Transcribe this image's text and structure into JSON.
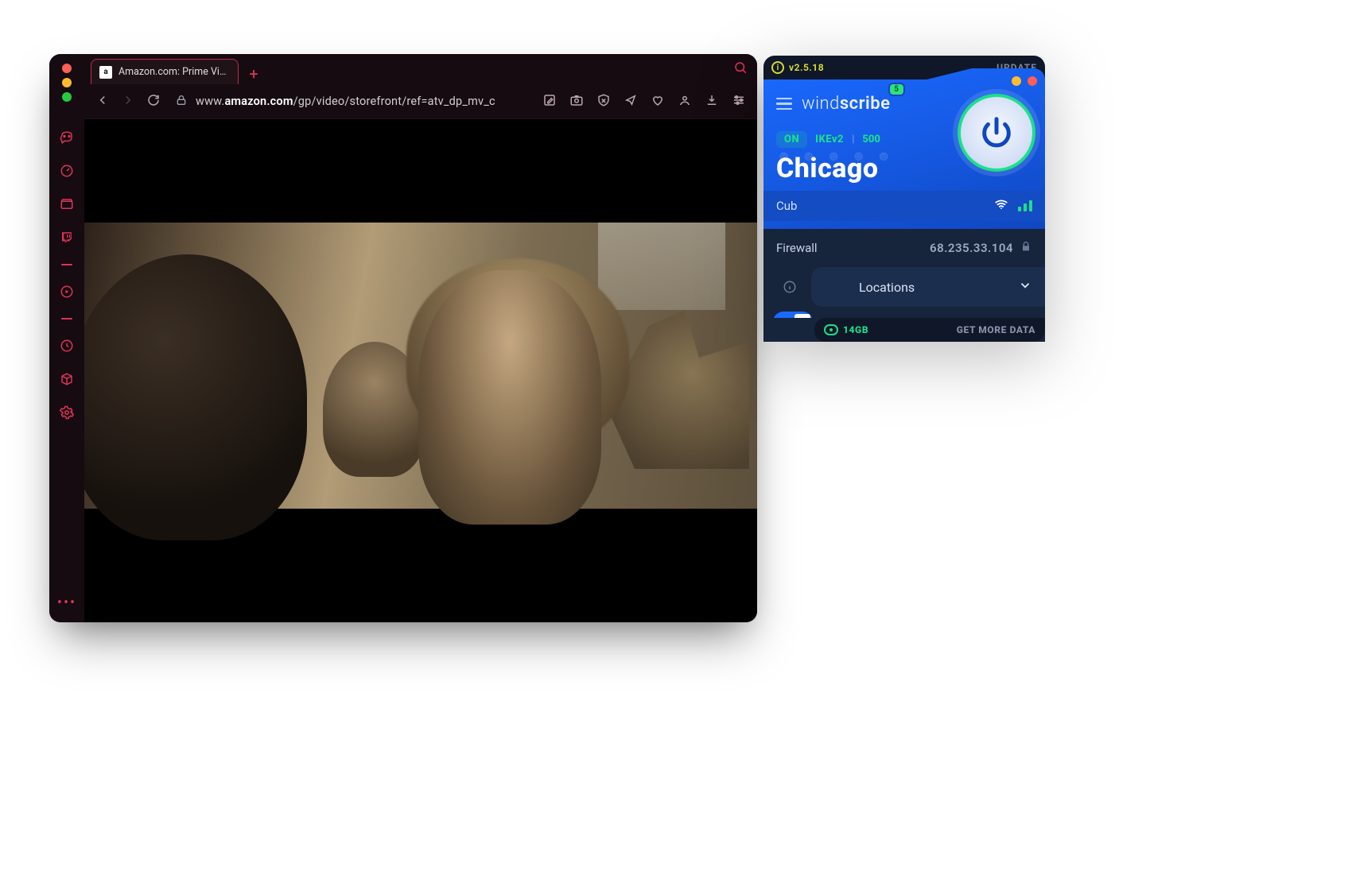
{
  "browser": {
    "tab_title": "Amazon.com: Prime Video: Prim",
    "favicon_letter": "a",
    "url_prefix": "www.",
    "url_host": "amazon.com",
    "url_path": "/gp/video/storefront/ref=atv_dp_mv_c"
  },
  "windscribe": {
    "version": "v2.5.18",
    "update_label": "UPDATE",
    "brand": "windscribe",
    "notif_badge": "5",
    "status": "ON",
    "protocol": "IKEv2",
    "port": "500",
    "location": "Chicago",
    "sublocation": "Cub",
    "firewall_label": "Firewall",
    "ip": "68.235.33.104",
    "locations_label": "Locations",
    "data_left": "14GB",
    "get_more": "GET MORE DATA"
  }
}
